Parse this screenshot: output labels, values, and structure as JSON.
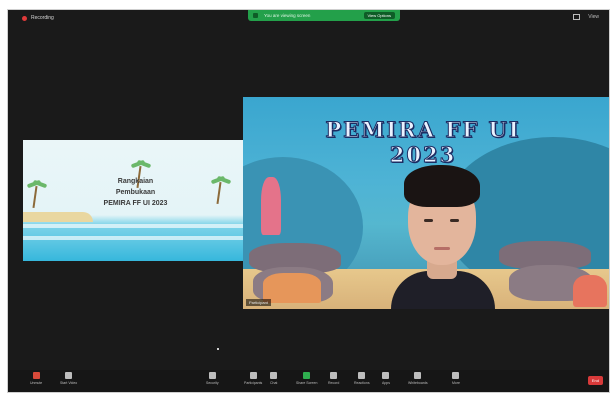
{
  "topbar": {
    "recording_label": "Recording",
    "share_banner_text": "You are viewing screen",
    "share_banner_button": "View Options",
    "view_label": "View"
  },
  "shared_screen": {
    "text_lines": [
      "Rangkaian",
      "Pembukaan",
      "PEMIRA FF UI 2023"
    ]
  },
  "video": {
    "banner_title": "PEMIRA FF UI 2023",
    "participant_name": "Participant"
  },
  "toolbar": {
    "items": [
      {
        "label": "Unmute",
        "icon": "mic-muted-icon",
        "color": "#d84a3a"
      },
      {
        "label": "Start Video",
        "icon": "video-icon",
        "color": "#bdbdbd"
      },
      {
        "label": "Security",
        "icon": "shield-icon",
        "color": "#bdbdbd"
      },
      {
        "label": "Participants",
        "icon": "participants-icon",
        "color": "#bdbdbd"
      },
      {
        "label": "Chat",
        "icon": "chat-icon",
        "color": "#bdbdbd"
      },
      {
        "label": "Share Screen",
        "icon": "share-screen-icon",
        "color": "#2fae4f"
      },
      {
        "label": "Record",
        "icon": "record-icon",
        "color": "#bdbdbd"
      },
      {
        "label": "Reactions",
        "icon": "reactions-icon",
        "color": "#bdbdbd"
      },
      {
        "label": "Apps",
        "icon": "apps-icon",
        "color": "#bdbdbd"
      },
      {
        "label": "Whiteboards",
        "icon": "whiteboard-icon",
        "color": "#bdbdbd"
      },
      {
        "label": "More",
        "icon": "more-icon",
        "color": "#bdbdbd"
      }
    ],
    "end_label": "End"
  }
}
